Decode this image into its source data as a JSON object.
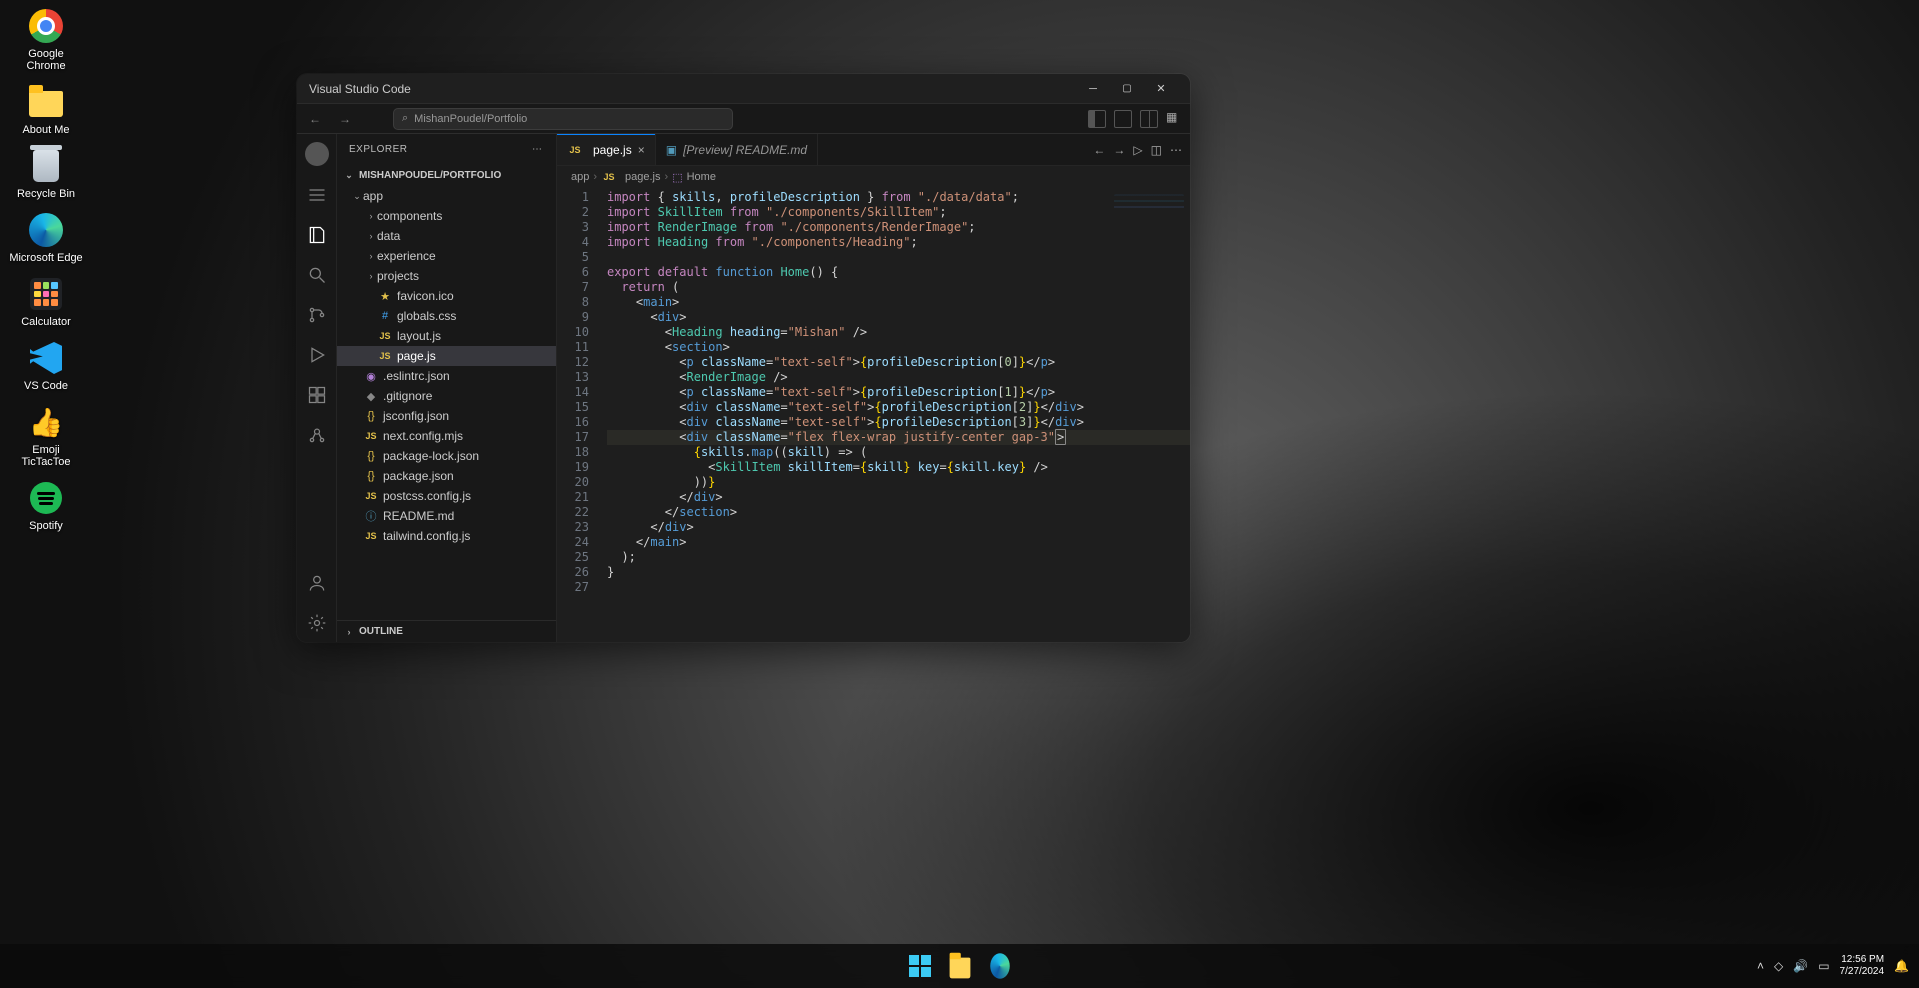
{
  "desktop_icons": [
    {
      "name": "google-chrome",
      "label": "Google Chrome"
    },
    {
      "name": "about-me",
      "label": "About Me"
    },
    {
      "name": "recycle-bin",
      "label": "Recycle Bin"
    },
    {
      "name": "microsoft-edge",
      "label": "Microsoft Edge"
    },
    {
      "name": "calculator",
      "label": "Calculator"
    },
    {
      "name": "vs-code",
      "label": "VS Code"
    },
    {
      "name": "emoji-tictactoe",
      "label": "Emoji TicTacToe"
    },
    {
      "name": "spotify",
      "label": "Spotify"
    }
  ],
  "window": {
    "title": "Visual Studio Code",
    "search": "MishanPoudel/Portfolio"
  },
  "explorer": {
    "title": "EXPLORER",
    "project": "MISHANPOUDEL/PORTFOLIO",
    "outline": "OUTLINE",
    "tree": {
      "app": "app",
      "components": "components",
      "data": "data",
      "experience": "experience",
      "projects": "projects",
      "favicon": "favicon.ico",
      "globals": "globals.css",
      "layout": "layout.js",
      "page": "page.js",
      "eslint": ".eslintrc.json",
      "gitignore": ".gitignore",
      "jsconfig": "jsconfig.json",
      "nextconfig": "next.config.mjs",
      "packagelock": "package-lock.json",
      "package": "package.json",
      "postcss": "postcss.config.js",
      "readme": "README.md",
      "tailwind": "tailwind.config.js"
    }
  },
  "tabs": {
    "active": "page.js",
    "preview": "[Preview] README.md"
  },
  "breadcrumbs": {
    "p0": "app",
    "p1": "page.js",
    "p2": "Home"
  },
  "code_tokens": {
    "import": "import",
    "from": "from",
    "export": "export",
    "default": "default",
    "function": "function",
    "return": "return",
    "skills": "skills",
    "profileDescription": "profileDescription",
    "Home": "Home",
    "SkillItem": "SkillItem",
    "RenderImage": "RenderImage",
    "Heading": "Heading",
    "path_data": "\"./data/data\"",
    "path_skill": "\"./components/SkillItem\"",
    "path_render": "\"./components/RenderImage\"",
    "path_heading": "\"./components/Heading\"",
    "main": "main",
    "div": "div",
    "p": "p",
    "section": "section",
    "heading_attr": "heading",
    "mishan": "\"Mishan\"",
    "className": "className",
    "textself": "\"text-self\"",
    "flexwrap": "\"flex flex-wrap justify-center gap-3\"",
    "map": "map",
    "skill": "skill",
    "key": "key",
    "skillItem": "skillItem",
    "skillkey": "skill.key"
  },
  "line_numbers": [
    "1",
    "2",
    "3",
    "4",
    "5",
    "6",
    "7",
    "8",
    "9",
    "10",
    "11",
    "12",
    "13",
    "14",
    "15",
    "16",
    "17",
    "18",
    "19",
    "20",
    "21",
    "22",
    "23",
    "24",
    "25",
    "26",
    "27"
  ],
  "taskbar": {
    "time": "12:56 PM",
    "date": "7/27/2024"
  }
}
